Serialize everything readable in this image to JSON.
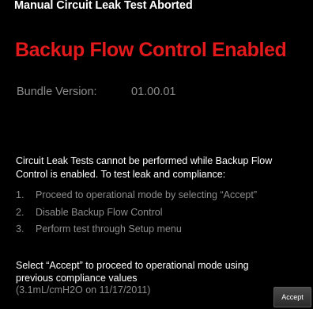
{
  "dialog": {
    "title": "Manual Circuit Leak Test Aborted",
    "headline": "Backup Flow Control Enabled",
    "bundle_label": "Bundle Version:",
    "bundle_value": "01.00.01",
    "message": "Circuit Leak Tests cannot be performed while Backup Flow Control is enabled.  To test leak and compliance:",
    "steps": [
      {
        "number": "1.",
        "text": "Proceed to operational mode by selecting “Accept”"
      },
      {
        "number": "2.",
        "text": "Disable Backup Flow Control"
      },
      {
        "number": "3.",
        "text": "Perform test through Setup menu"
      }
    ],
    "prompt": "Select “Accept” to proceed to operational mode using previous compliance values",
    "previous_values": "(3.1mL/cmH2O on 11/17/2011)",
    "accept_label": "Accept"
  },
  "colors": {
    "background": "#000000",
    "headline": "#e31a1c",
    "muted_text": "#8d8d8d",
    "primary_text": "#ffffff"
  }
}
